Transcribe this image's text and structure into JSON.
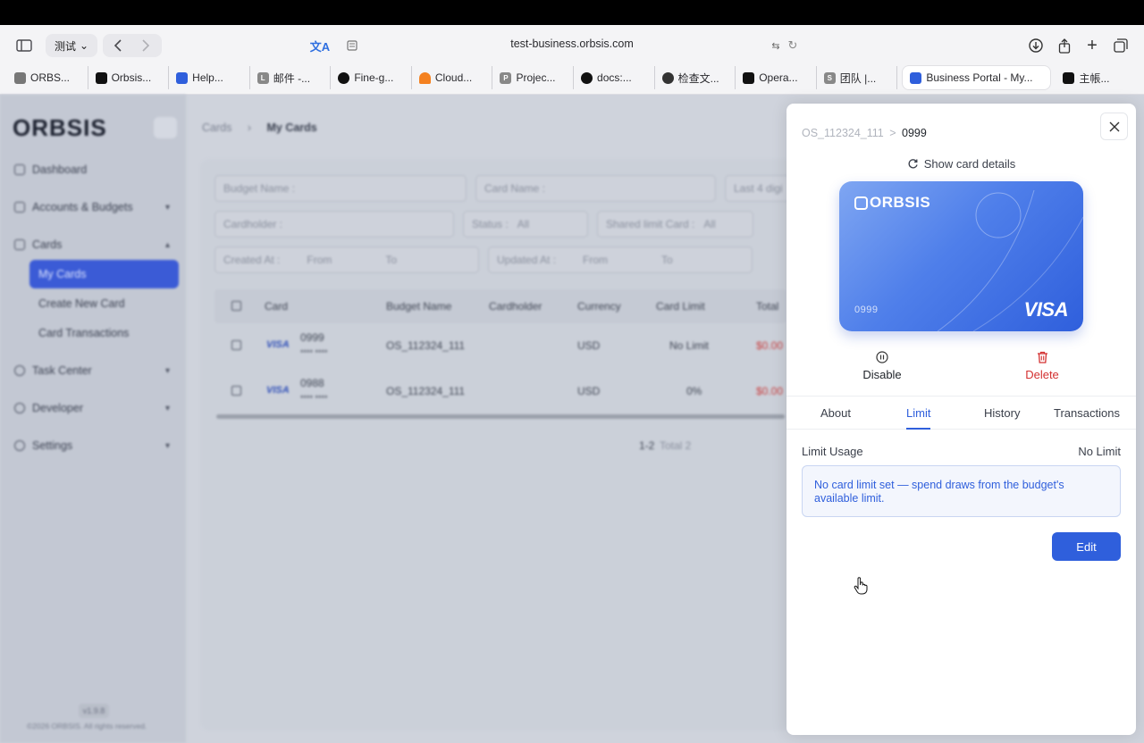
{
  "browser": {
    "profile_label": "测试",
    "url": "test-business.orbsis.com",
    "tabs": [
      {
        "label": "ORBS...",
        "color": "#555"
      },
      {
        "label": "Orbsis...",
        "color": "#111"
      },
      {
        "label": "Help...",
        "color": "#2f5fdc"
      },
      {
        "label": "邮件 -...",
        "color": "#888"
      },
      {
        "label": "Fine-g...",
        "color": "#111"
      },
      {
        "label": "Cloud...",
        "color": "#f48120"
      },
      {
        "label": "Projec...",
        "color": "#888"
      },
      {
        "label": "docs:...",
        "color": "#111"
      },
      {
        "label": "检查文...",
        "color": "#333"
      },
      {
        "label": "Opera...",
        "color": "#111"
      },
      {
        "label": "团队 |...",
        "color": "#888"
      },
      {
        "label": "Business Portal - My...",
        "color": "#2f5fdc"
      },
      {
        "label": "主帳...",
        "color": "#111"
      }
    ]
  },
  "sidebar": {
    "logo": "ORBSIS",
    "items": [
      {
        "label": "Dashboard"
      },
      {
        "label": "Accounts & Budgets"
      },
      {
        "label": "Cards"
      },
      {
        "label": "Task Center"
      },
      {
        "label": "Developer"
      },
      {
        "label": "Settings"
      }
    ],
    "card_sub_items": [
      {
        "label": "My Cards"
      },
      {
        "label": "Create New Card"
      },
      {
        "label": "Card Transactions"
      }
    ],
    "version": "v1.9.8",
    "copyright": "©2026 ORBSIS. All rights reserved."
  },
  "main": {
    "breadcrumb_parent": "Cards",
    "breadcrumb_current": "My Cards",
    "filters": {
      "budget_name": "Budget Name :",
      "card_name": "Card Name :",
      "last4": "Last 4 digi",
      "cardholder": "Cardholder :",
      "status_label": "Status :",
      "status_value": "All",
      "shared_label": "Shared limit Card :",
      "shared_value": "All",
      "created_at": "Created At :",
      "created_from": "From",
      "created_to": "To",
      "updated_at": "Updated At :",
      "updated_from": "From",
      "updated_to": "To"
    },
    "columns": [
      "Card",
      "Budget Name",
      "Cardholder",
      "Currency",
      "Card Limit",
      "Total"
    ],
    "rows": [
      {
        "card": "0999",
        "masked": "**** ****",
        "budget": "OS_112324_111",
        "currency": "USD",
        "limit": "No Limit",
        "total": "$0.00"
      },
      {
        "card": "0988",
        "masked": "**** ****",
        "budget": "OS_112324_111",
        "currency": "USD",
        "limit": "0%",
        "total": "$0.00"
      }
    ],
    "visa": "VISA",
    "pagination_range": "1-2",
    "pagination_total": "Total 2"
  },
  "drawer": {
    "breadcrumb_parent": "OS_112324_111",
    "breadcrumb_sep": ">",
    "breadcrumb_current": "0999",
    "show_details": "Show card details",
    "card": {
      "logo": "ORBSIS",
      "number": "0999",
      "network": "VISA"
    },
    "actions": {
      "disable": "Disable",
      "delete": "Delete"
    },
    "tabs": [
      "About",
      "Limit",
      "History",
      "Transactions"
    ],
    "active_tab": "Limit",
    "limit_usage_label": "Limit Usage",
    "limit_usage_value": "No Limit",
    "notice": "No card limit set — spend draws from the budget's available limit.",
    "edit_label": "Edit"
  },
  "colors": {
    "accent": "#2f5fdc",
    "danger": "#d33030"
  }
}
